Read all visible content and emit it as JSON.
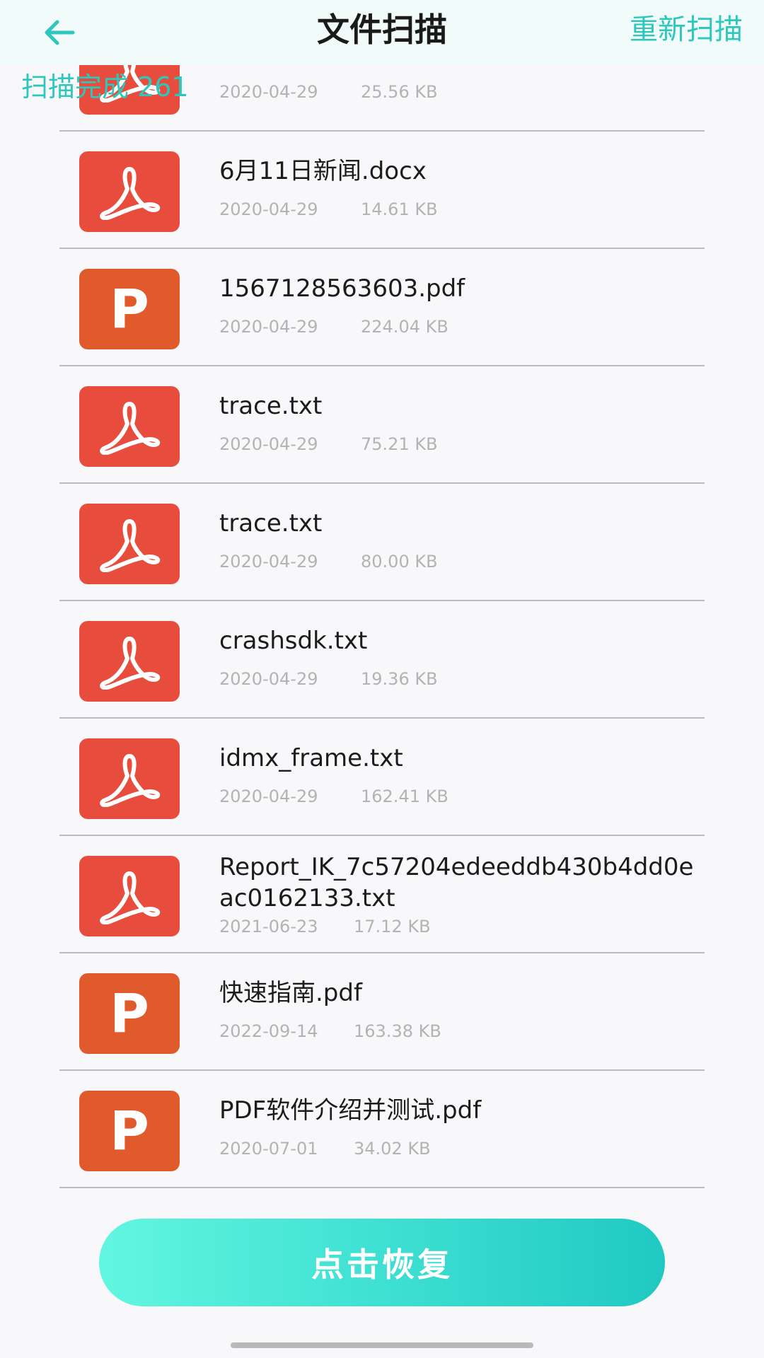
{
  "header": {
    "title": "文件扫描",
    "rescan_label": "重新扫描",
    "back_icon": "arrow-left-icon",
    "accent_color": "#2dc7bd"
  },
  "scan_status": "扫描完成 261",
  "files": [
    {
      "name": "",
      "date": "2020-04-29",
      "size": "25.56 KB",
      "icon": "acrobat-icon",
      "partial": true
    },
    {
      "name": "6月11日新闻.docx",
      "date": "2020-04-29",
      "size": "14.61 KB",
      "icon": "acrobat-icon"
    },
    {
      "name": "1567128563603.pdf",
      "date": "2020-04-29",
      "size": "224.04 KB",
      "icon": "powerpoint-icon"
    },
    {
      "name": "trace.txt",
      "date": "2020-04-29",
      "size": "75.21 KB",
      "icon": "acrobat-icon"
    },
    {
      "name": "trace.txt",
      "date": "2020-04-29",
      "size": "80.00 KB",
      "icon": "acrobat-icon"
    },
    {
      "name": "crashsdk.txt",
      "date": "2020-04-29",
      "size": "19.36 KB",
      "icon": "acrobat-icon"
    },
    {
      "name": "idmx_frame.txt",
      "date": "2020-04-29",
      "size": "162.41 KB",
      "icon": "acrobat-icon"
    },
    {
      "name": "Report_IK_7c57204edeeddb430b4dd0eac0162133.txt",
      "date": "2021-06-23",
      "size": "17.12 KB",
      "icon": "acrobat-icon"
    },
    {
      "name": "快速指南.pdf",
      "date": "2022-09-14",
      "size": "163.38 KB",
      "icon": "powerpoint-icon"
    },
    {
      "name": "PDF软件介绍并测试.pdf",
      "date": "2020-07-01",
      "size": "34.02 KB",
      "icon": "powerpoint-icon"
    }
  ],
  "restore_label": "点击恢复",
  "colors": {
    "pdf_icon_bg": "#e74c3c",
    "ppt_icon_bg": "#e05a2b",
    "button_gradient_start": "#62f6e0",
    "button_gradient_end": "#1fc9c2"
  }
}
